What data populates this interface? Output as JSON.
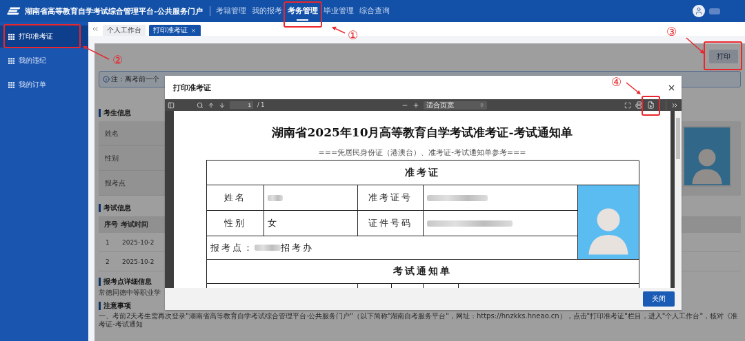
{
  "header": {
    "title": "湖南省高等教育自学考试综合管理平台-公共服务门户",
    "nav": [
      {
        "label": "考籍管理",
        "selected": false
      },
      {
        "label": "我的报考",
        "selected": false
      },
      {
        "label": "考务管理",
        "selected": true
      },
      {
        "label": "毕业管理",
        "selected": false
      },
      {
        "label": "综合查询",
        "selected": false
      }
    ]
  },
  "sidebar": {
    "items": [
      {
        "label": "打印准考证",
        "selected": true
      },
      {
        "label": "我的违纪",
        "selected": false
      },
      {
        "label": "我的订单",
        "selected": false
      }
    ]
  },
  "tabs": [
    {
      "label": "个人工作台",
      "selected": false,
      "closable": false
    },
    {
      "label": "打印准考证",
      "selected": true,
      "closable": true
    }
  ],
  "page": {
    "print_button": "打印",
    "notice": "注：离考前一个",
    "candidate_info": {
      "title": "考生信息",
      "fields": [
        "姓名",
        "性别",
        "报考点"
      ]
    },
    "exam_info": {
      "title": "考试信息",
      "columns": [
        "序号",
        "考试时间"
      ],
      "rows": [
        [
          "1",
          "2025-10-2"
        ],
        [
          "2",
          "2025-10-2"
        ]
      ]
    },
    "site_detail": {
      "title": "报考点详细信息",
      "text": "常德同德中等职业学"
    },
    "notes": {
      "title": "注意事项",
      "text": "一、考前2天考生需再次登录\"湖南省高等教育自学考试综合管理平台·公共服务门户\"（以下简称\"湖南自考服务平台\"，网址：https://hnzkks.hneao.cn），点击\"打印准考证\"栏目，进入\"个人工作台\"，核对《准考证-考试通知"
    }
  },
  "dialog": {
    "title": "打印准考证",
    "page_input": "1",
    "page_total": "/ 1",
    "zoom": "适合页宽",
    "close_button": "关闭",
    "document": {
      "title": "湖南省2025年10月高等教育自学考试准考证-考试通知单",
      "subtitle": "===凭居民身份证（港澳台）、准考证-考试通知单参考===",
      "admit_header": "准考证",
      "name_label": "姓名",
      "id_label": "准考证号",
      "gender_label": "性别",
      "gender_value": "女",
      "doc_label": "证件号码",
      "site_label": "报考点：",
      "site_suffix": "招考办",
      "notice_header": "考试通知单"
    }
  },
  "annotations": [
    {
      "label": "①"
    },
    {
      "label": "②"
    },
    {
      "label": "③"
    },
    {
      "label": "④"
    }
  ]
}
